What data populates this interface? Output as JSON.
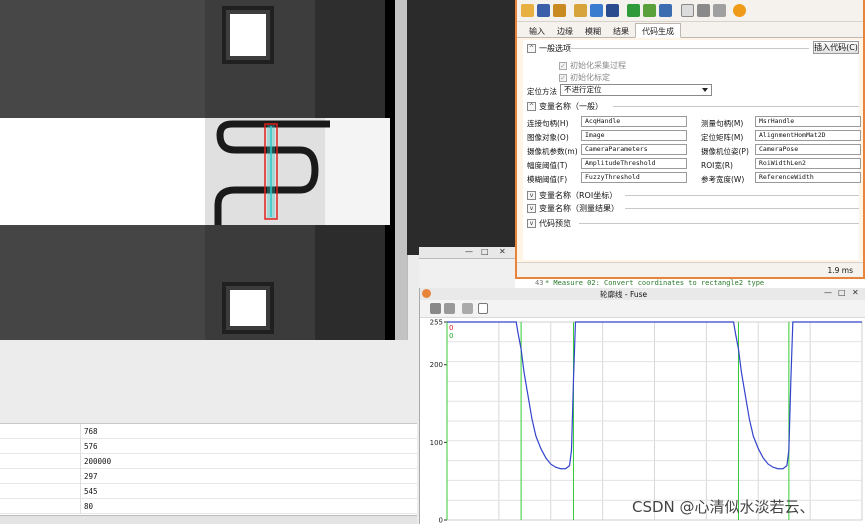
{
  "codegen": {
    "tabs": [
      "输入",
      "边缘",
      "模糊",
      "结果",
      "代码生成"
    ],
    "active_tab": "代码生成",
    "general_section": "一般选项",
    "insert_button": "插入代码(C)",
    "check_init_acq": "初始化采集过程",
    "check_init_calib": "初始化标定",
    "position_label": "定位方法",
    "position_value": "不进行定位",
    "var_section": "变量名称（一般）",
    "fields": [
      {
        "label": "连接句柄(H)",
        "value": "AcqHandle"
      },
      {
        "label": "测量句柄(M)",
        "value": "MsrHandle"
      },
      {
        "label": "图像对象(O)",
        "value": "Image"
      },
      {
        "label": "定位矩阵(M)",
        "value": "AlignmentHomMat2D"
      },
      {
        "label": "摄像机参数(m)",
        "value": "CameraParameters"
      },
      {
        "label": "摄像机位姿(P)",
        "value": "CameraPose"
      },
      {
        "label": "幅度阈值(T)",
        "value": "AmplitudeThreshold"
      },
      {
        "label": "ROI宽(R)",
        "value": "RoiWidthLen2"
      },
      {
        "label": "模糊阈值(F)",
        "value": "FuzzyThreshold"
      },
      {
        "label": "参考宽度(W)",
        "value": "ReferenceWidth"
      }
    ],
    "roi_section": "变量名称（ROI坐标）",
    "meas_section": "变量名称（测量结果）",
    "preview_section": "代码预览",
    "status_time": "1.9 ms"
  },
  "code_strip": {
    "line_no": "43",
    "text": "* Measure 02: Convert coordinates to rectangle2 type"
  },
  "list": {
    "values": [
      "768",
      "576",
      "200000",
      "297",
      "545",
      "80"
    ]
  },
  "profile": {
    "title": "轮廓线 - Fuse",
    "ctrl_minimize": "—",
    "ctrl_maximize": "□",
    "ctrl_close": "✕",
    "markers": [
      "0",
      "0"
    ]
  },
  "mid_panel": {
    "ctrl_minimize": "—",
    "ctrl_maximize": "□",
    "ctrl_close": "✕"
  },
  "chart_data": {
    "type": "line",
    "xlabel": "",
    "ylabel": "",
    "ylim": [
      0,
      255
    ],
    "yticks": [
      0,
      100,
      200,
      255
    ],
    "grid": true,
    "series": [
      {
        "color": "#3344cc",
        "x": [
          0,
          70,
          72,
          75,
          78,
          82,
          86,
          90,
          95,
          100,
          105,
          110,
          115,
          120,
          124,
          126,
          128,
          130,
          290,
          292,
          295,
          298,
          302,
          306,
          310,
          315,
          320,
          325,
          330,
          335,
          340,
          344,
          346,
          348,
          350,
          420
        ],
        "values": [
          255,
          255,
          240,
          220,
          190,
          160,
          130,
          108,
          92,
          80,
          72,
          68,
          66,
          66,
          70,
          90,
          180,
          255,
          255,
          240,
          220,
          190,
          160,
          130,
          108,
          92,
          80,
          72,
          68,
          66,
          66,
          70,
          90,
          180,
          255,
          255
        ]
      }
    ],
    "vertical_markers_color": "#33cc33",
    "vertical_markers_x": [
      0,
      75,
      128,
      295,
      346
    ]
  },
  "colors": {
    "window_border": "#e8833a",
    "roi_rect": "#e0201a",
    "roi_line": "#33c6c6"
  },
  "watermark": "CSDN @心清似水淡若云、"
}
